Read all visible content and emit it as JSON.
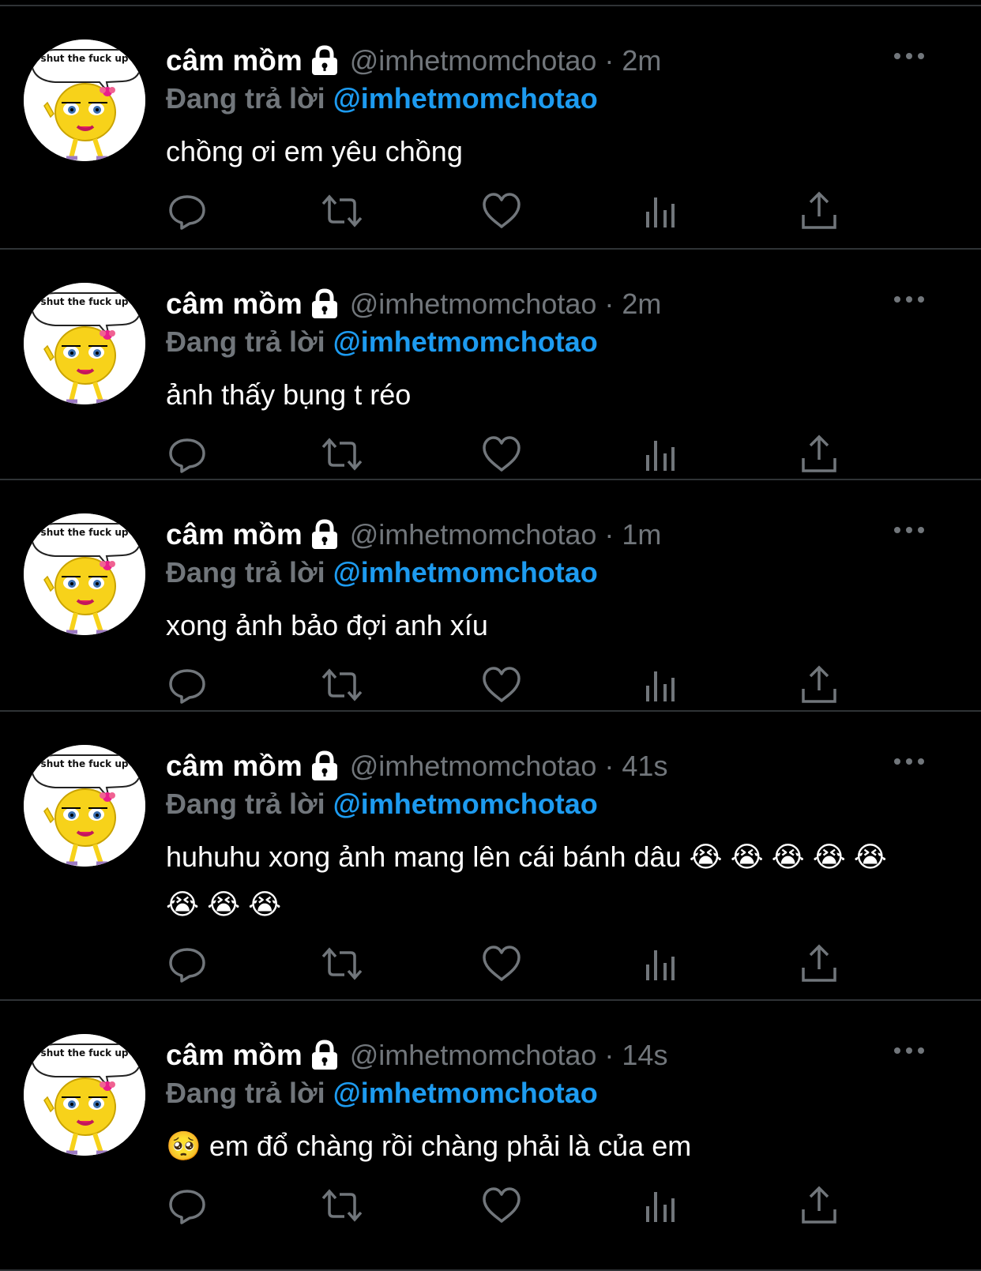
{
  "tweets": [
    {
      "name": "câm mồm",
      "handle": "@imhetmomchotao",
      "dot": "·",
      "time": "2m",
      "reply_prefix": "Đang trả lời",
      "reply_target": "@imhetmomchotao",
      "text": "chồng ơi em yêu chồng",
      "avatar_caption": "shut the fuck up"
    },
    {
      "name": "câm mồm",
      "handle": "@imhetmomchotao",
      "dot": "·",
      "time": "2m",
      "reply_prefix": "Đang trả lời",
      "reply_target": "@imhetmomchotao",
      "text": "ảnh thấy bụng t réo",
      "avatar_caption": "shut the fuck up"
    },
    {
      "name": "câm mồm",
      "handle": "@imhetmomchotao",
      "dot": "·",
      "time": "1m",
      "reply_prefix": "Đang trả lời",
      "reply_target": "@imhetmomchotao",
      "text": "xong ảnh bảo đợi anh xíu",
      "avatar_caption": "shut the fuck up"
    },
    {
      "name": "câm mồm",
      "handle": "@imhetmomchotao",
      "dot": "·",
      "time": "41s",
      "reply_prefix": "Đang trả lời",
      "reply_target": "@imhetmomchotao",
      "text": "huhuhu xong ảnh mang lên cái bánh dâu 😭 😭 😭 😭 😭 😭 😭 😭",
      "avatar_caption": "shut the fuck up"
    },
    {
      "name": "câm mồm",
      "handle": "@imhetmomchotao",
      "dot": "·",
      "time": "14s",
      "reply_prefix": "Đang trả lời",
      "reply_target": "@imhetmomchotao",
      "text": "🥺 em đổ chàng rồi chàng phải là của em",
      "avatar_caption": "shut the fuck up"
    }
  ],
  "icons": {
    "lock": "lock-icon",
    "more": "more-icon",
    "reply": "reply-icon",
    "retweet": "retweet-icon",
    "like": "heart-icon",
    "views": "views-icon",
    "share": "share-icon"
  },
  "colors": {
    "background": "#000000",
    "divider": "#2f3336",
    "name": "#ffffff",
    "muted": "#71767b",
    "link": "#1d9bf0"
  }
}
